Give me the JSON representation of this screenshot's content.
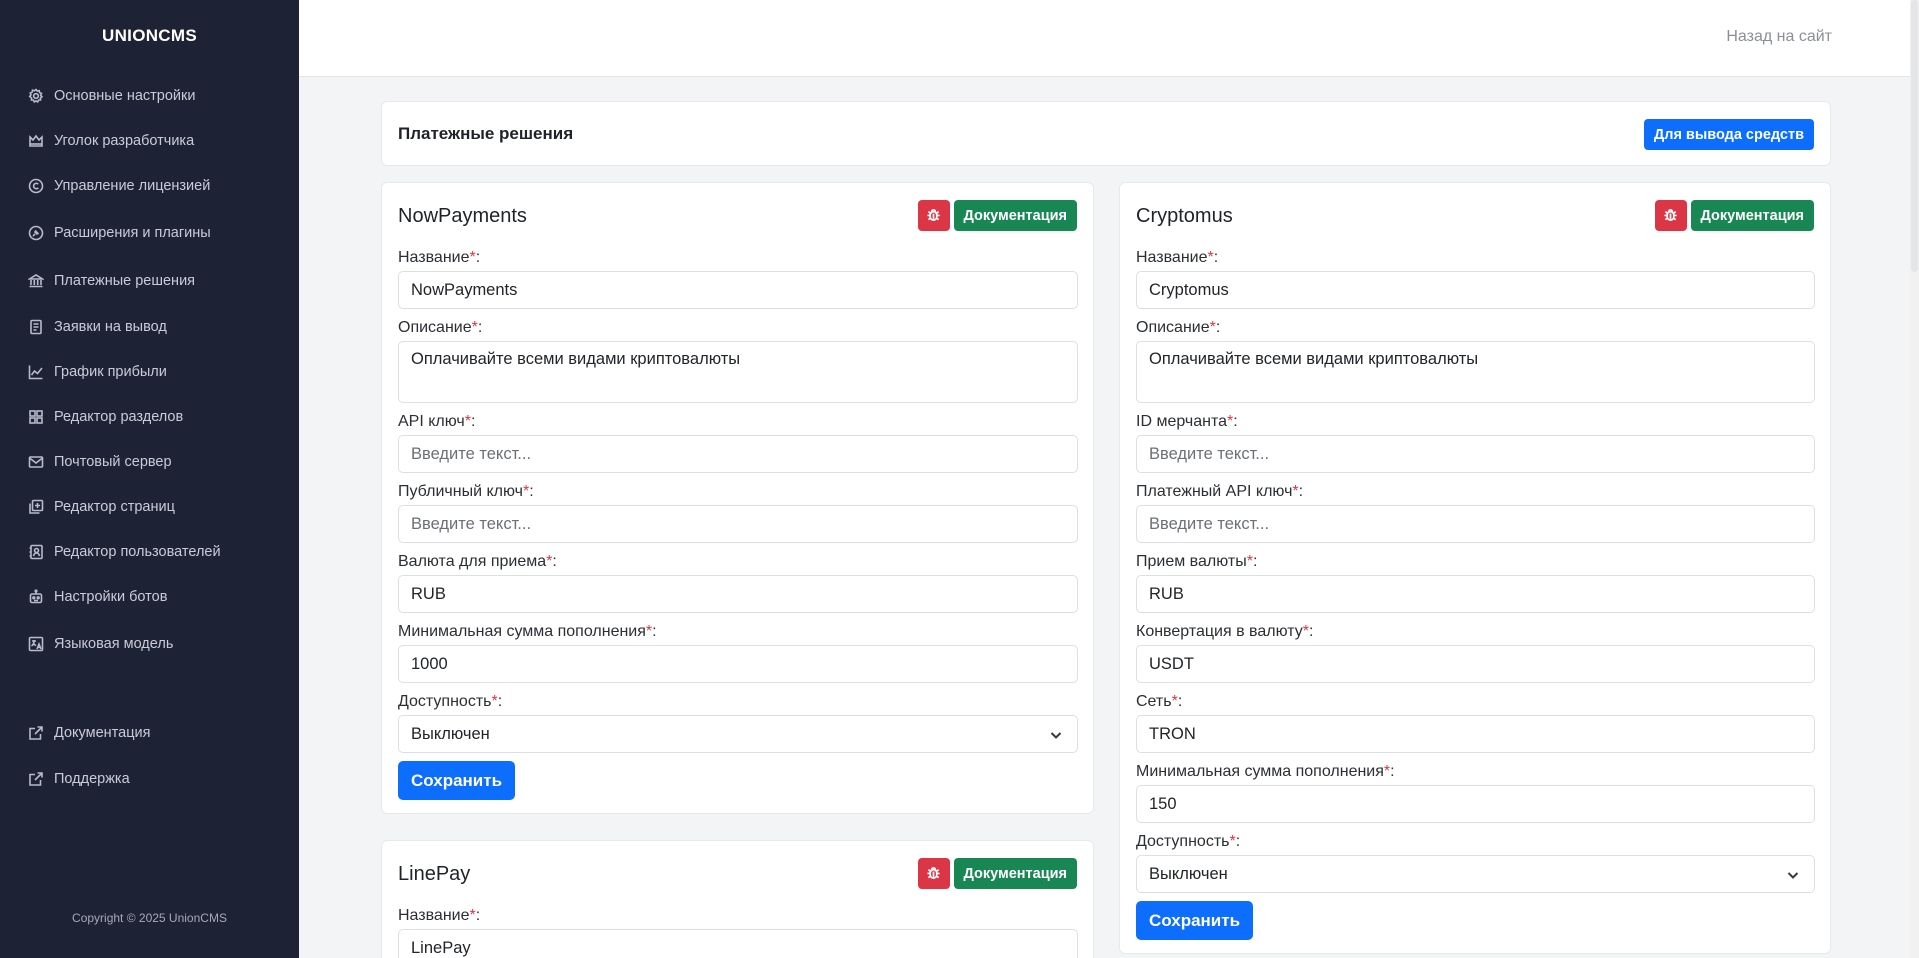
{
  "brand": "UNIONCMS",
  "sidebar": {
    "items": [
      {
        "label": "Основные настройки",
        "icon": "gear-icon"
      },
      {
        "label": "Уголок разработчика",
        "icon": "crown-icon"
      },
      {
        "label": "Управление лицензией",
        "icon": "copyright-icon"
      },
      {
        "label": "Расширения и плагины",
        "icon": "plugin-icon"
      },
      {
        "label": "Платежные решения",
        "icon": "bank-icon"
      },
      {
        "label": "Заявки на вывод",
        "icon": "receipt-icon"
      },
      {
        "label": "График прибыли",
        "icon": "chart-line-icon"
      },
      {
        "label": "Редактор разделов",
        "icon": "grid-icon"
      },
      {
        "label": "Почтовый сервер",
        "icon": "mail-icon"
      },
      {
        "label": "Редактор страниц",
        "icon": "pages-icon"
      },
      {
        "label": "Редактор пользователей",
        "icon": "users-book-icon"
      },
      {
        "label": "Настройки ботов",
        "icon": "robot-icon"
      },
      {
        "label": "Языковая модель",
        "icon": "translate-icon"
      }
    ],
    "bottom_items": [
      {
        "label": "Документация",
        "icon": "external-link-icon"
      },
      {
        "label": "Поддержка",
        "icon": "external-link-icon"
      }
    ],
    "copyright": "Copyright © 2025 UnionCMS"
  },
  "topbar": {
    "back_link": "Назад на сайт"
  },
  "header": {
    "title": "Платежные решения",
    "withdraw_button": "Для вывода средств"
  },
  "common": {
    "doc_button": "Документация",
    "save_button": "Сохранить",
    "required_mark": "*",
    "colon": ":"
  },
  "nowpayments": {
    "title": "NowPayments",
    "fields": {
      "name_label": "Название",
      "name_value": "NowPayments",
      "desc_label": "Описание",
      "desc_value": "Оплачивайте всеми видами криптовалюты",
      "api_label": "API ключ",
      "api_placeholder": "Введите текст...",
      "public_label": "Публичный ключ",
      "public_placeholder": "Введите текст...",
      "currency_label": "Валюта для приема",
      "currency_value": "RUB",
      "min_label": "Минимальная сумма пополнения",
      "min_value": "1000",
      "avail_label": "Доступность",
      "avail_value": "Выключен"
    }
  },
  "cryptomus": {
    "title": "Cryptomus",
    "fields": {
      "name_label": "Название",
      "name_value": "Cryptomus",
      "desc_label": "Описание",
      "desc_value": "Оплачивайте всеми видами криптовалюты",
      "merchant_label": "ID мерчанта",
      "merchant_placeholder": "Введите текст...",
      "payapi_label": "Платежный API ключ",
      "payapi_placeholder": "Введите текст...",
      "currency_label": "Прием валюты",
      "currency_value": "RUB",
      "convert_label": "Конвертация в валюту",
      "convert_value": "USDT",
      "network_label": "Сеть",
      "network_value": "TRON",
      "min_label": "Минимальная сумма пополнения",
      "min_value": "150",
      "avail_label": "Доступность",
      "avail_value": "Выключен"
    }
  },
  "linepay": {
    "title": "LinePay",
    "fields": {
      "name_label": "Название",
      "name_value": "LinePay"
    }
  },
  "colors": {
    "sidebar_bg": "#1d2235",
    "primary": "#0d6efd",
    "success": "#198754",
    "danger": "#dc3545"
  }
}
